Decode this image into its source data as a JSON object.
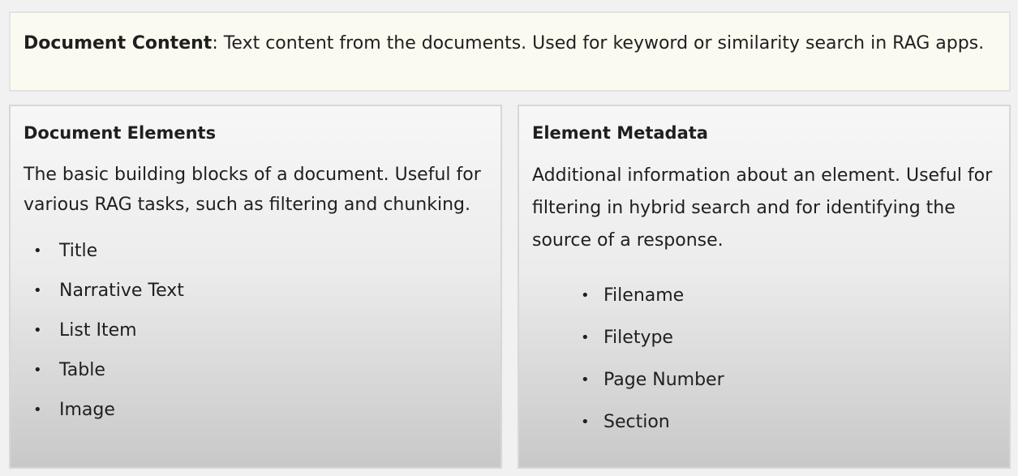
{
  "top_box": {
    "bold_label": "Document Content",
    "text": ": Text content from the documents. Used for keyword or similarity search in RAG apps."
  },
  "left_panel": {
    "title": "Document Elements",
    "description": "The basic building blocks of a document. Useful for various RAG tasks, such as filtering and chunking.",
    "items": [
      "Title",
      "Narrative Text",
      "List Item",
      "Table",
      "Image"
    ]
  },
  "right_panel": {
    "title": "Element Metadata",
    "description": "Additional information about an element. Useful for filtering in hybrid search and for identifying the source of a response.",
    "items": [
      "Filename",
      "Filetype",
      "Page Number",
      "Section"
    ]
  },
  "bullet_glyph": "•"
}
